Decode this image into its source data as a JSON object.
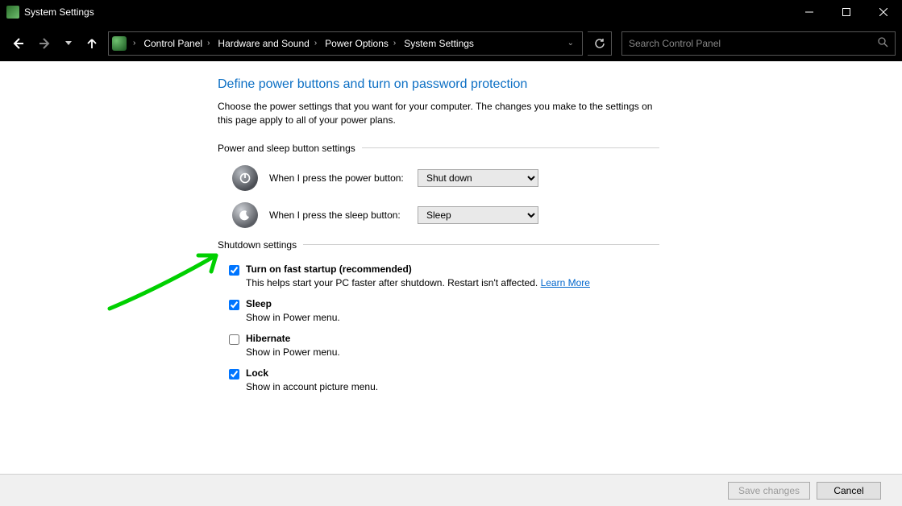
{
  "window": {
    "title": "System Settings"
  },
  "breadcrumb": {
    "items": [
      "Control Panel",
      "Hardware and Sound",
      "Power Options",
      "System Settings"
    ]
  },
  "search": {
    "placeholder": "Search Control Panel"
  },
  "page": {
    "heading": "Define power buttons and turn on password protection",
    "description": "Choose the power settings that you want for your computer. The changes you make to the settings on this page apply to all of your power plans.",
    "section1": "Power and sleep button settings",
    "power_btn_label": "When I press the power button:",
    "power_btn_value": "Shut down",
    "sleep_btn_label": "When I press the sleep button:",
    "sleep_btn_value": "Sleep",
    "section2": "Shutdown settings",
    "cb": [
      {
        "title": "Turn on fast startup (recommended)",
        "desc_a": "This helps start your PC faster after shutdown. Restart isn't affected. ",
        "link": "Learn More",
        "checked": true
      },
      {
        "title": "Sleep",
        "desc_a": "Show in Power menu.",
        "link": "",
        "checked": true
      },
      {
        "title": "Hibernate",
        "desc_a": "Show in Power menu.",
        "link": "",
        "checked": false
      },
      {
        "title": "Lock",
        "desc_a": "Show in account picture menu.",
        "link": "",
        "checked": true
      }
    ]
  },
  "footer": {
    "save": "Save changes",
    "cancel": "Cancel"
  }
}
